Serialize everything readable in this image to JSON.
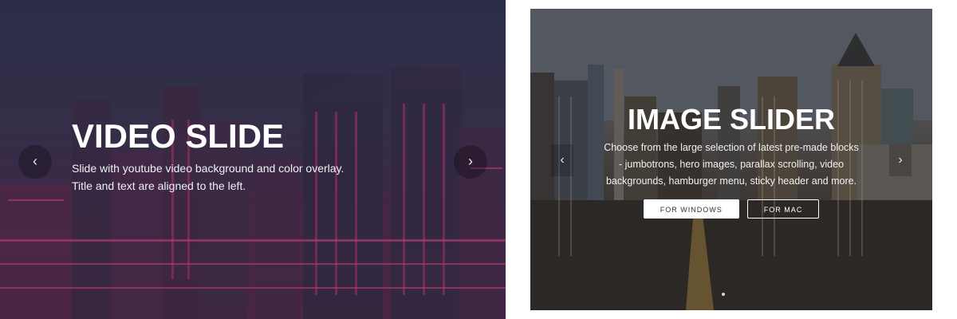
{
  "video_slide": {
    "title": "VIDEO SLIDE",
    "description_line1": "Slide with youtube video background and color overlay.",
    "description_line2": "Title and text are aligned to the left.",
    "prev_arrow": "‹",
    "next_arrow": "›",
    "overlay_color": "#2c2f48"
  },
  "image_slide": {
    "title": "IMAGE SLIDER",
    "description_line1": "Choose from the large selection of latest pre-made blocks",
    "description_line2": "- jumbotrons, hero images, parallax scrolling, video",
    "description_line3": "backgrounds, hamburger menu, sticky header and more.",
    "button_primary": "FOR WINDOWS",
    "button_secondary": "FOR MAC",
    "prev_arrow": "‹",
    "next_arrow": "›"
  }
}
